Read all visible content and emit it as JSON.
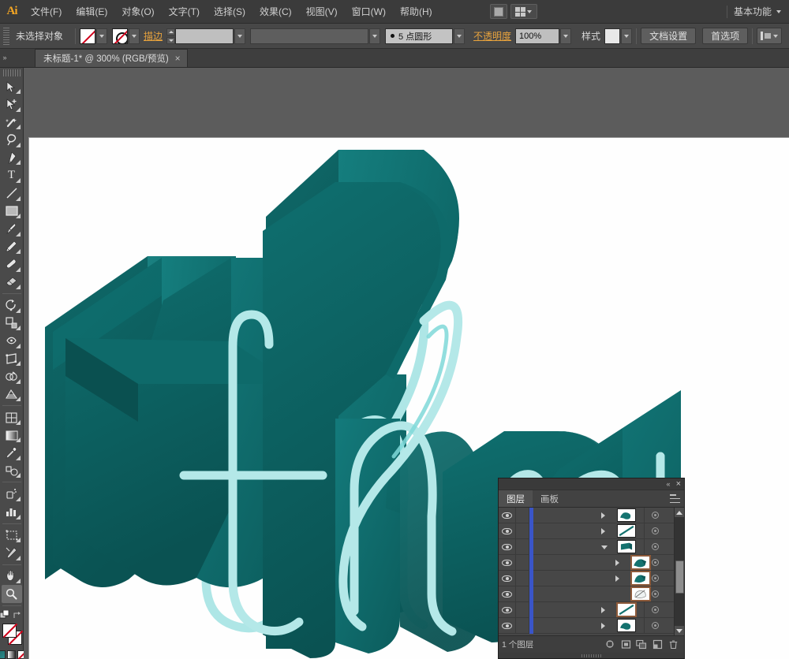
{
  "app": {
    "name": "Adobe Illustrator",
    "logo_text": "Ai",
    "workspace": "基本功能"
  },
  "menubar": {
    "items": [
      {
        "label": "文件(F)",
        "name": "menu-file"
      },
      {
        "label": "编辑(E)",
        "name": "menu-edit"
      },
      {
        "label": "对象(O)",
        "name": "menu-object"
      },
      {
        "label": "文字(T)",
        "name": "menu-type"
      },
      {
        "label": "选择(S)",
        "name": "menu-select"
      },
      {
        "label": "效果(C)",
        "name": "menu-effect"
      },
      {
        "label": "视图(V)",
        "name": "menu-view"
      },
      {
        "label": "窗口(W)",
        "name": "menu-window"
      },
      {
        "label": "帮助(H)",
        "name": "menu-help"
      }
    ],
    "bridge_icon": "bridge-icon",
    "arrange_icon": "arrange-documents-icon"
  },
  "controlbar": {
    "selection_status": "未选择对象",
    "fill_label": "fill-none",
    "stroke_swatch_label": "stroke-none",
    "stroke_link_label": "描边",
    "stroke_weight_value": "",
    "stroke_profile_value": "",
    "brush_definition": "5 点圆形",
    "opacity_label": "不透明度",
    "opacity_value": "100%",
    "style_label": "样式",
    "document_setup_button": "文档设置",
    "preferences_button": "首选项",
    "align_label": "align-options"
  },
  "tabbar": {
    "documents": [
      {
        "title": "未标题-1* @ 300% (RGB/预览)",
        "close": "×",
        "active": true
      }
    ]
  },
  "toolbar": {
    "tools": [
      {
        "name": "selection-tool",
        "glyph": "arrow"
      },
      {
        "name": "direct-selection-tool",
        "glyph": "arrow-plus"
      },
      {
        "name": "magic-wand-tool",
        "glyph": "wand"
      },
      {
        "name": "lasso-tool",
        "glyph": "lasso"
      },
      {
        "name": "pen-tool",
        "glyph": "pen"
      },
      {
        "name": "type-tool",
        "glyph": "T"
      },
      {
        "name": "line-segment-tool",
        "glyph": "line"
      },
      {
        "name": "rectangle-tool",
        "glyph": "rect"
      },
      {
        "name": "paintbrush-tool",
        "glyph": "brush"
      },
      {
        "name": "pencil-tool",
        "glyph": "pencil"
      },
      {
        "name": "blob-brush-tool",
        "glyph": "blob"
      },
      {
        "name": "eraser-tool",
        "glyph": "eraser"
      },
      {
        "name": "rotate-tool",
        "glyph": "rotate"
      },
      {
        "name": "scale-tool",
        "glyph": "scale"
      },
      {
        "name": "width-tool",
        "glyph": "width"
      },
      {
        "name": "free-transform-tool",
        "glyph": "transform"
      },
      {
        "name": "shape-builder-tool",
        "glyph": "shapebuilder"
      },
      {
        "name": "perspective-grid-tool",
        "glyph": "perspective"
      },
      {
        "name": "mesh-tool",
        "glyph": "mesh"
      },
      {
        "name": "gradient-tool",
        "glyph": "gradient"
      },
      {
        "name": "eyedropper-tool",
        "glyph": "eyedropper"
      },
      {
        "name": "blend-tool",
        "glyph": "blend"
      },
      {
        "name": "symbol-sprayer-tool",
        "glyph": "symbol"
      },
      {
        "name": "column-graph-tool",
        "glyph": "graph"
      },
      {
        "name": "artboard-tool",
        "glyph": "artboard"
      },
      {
        "name": "slice-tool",
        "glyph": "slice"
      },
      {
        "name": "hand-tool",
        "glyph": "hand"
      },
      {
        "name": "zoom-tool",
        "glyph": "zoom",
        "active": true
      }
    ],
    "fill_swatch": "none",
    "stroke_swatch": "none",
    "mode_color": "color-mode",
    "mode_gradient": "gradient-mode",
    "mode_none": "none-mode"
  },
  "canvas": {
    "zoom_level": "300%",
    "artwork_title": "thru",
    "colors": {
      "fill_teal": "#146e6e",
      "face_teal": "#0f7070",
      "extrude_dark": "#0d5f5f",
      "outline_cyan": "#aee6e6",
      "highlight_cyan": "#7fd8d8",
      "background": "#fefefe"
    }
  },
  "layers_panel": {
    "tabs": [
      {
        "label": "图层",
        "name": "tab-layers",
        "active": true
      },
      {
        "label": "画板",
        "name": "tab-artboards",
        "active": false
      }
    ],
    "title_controls": {
      "collapse": "«",
      "close": "×"
    },
    "rows": [
      {
        "name": "layer-row-1",
        "visible": true,
        "expanded": false,
        "indent": 0,
        "selected": false,
        "thumb": "art-teal-swirl"
      },
      {
        "name": "layer-row-2",
        "visible": true,
        "expanded": false,
        "indent": 0,
        "selected": false,
        "thumb": "art-teal-stroke"
      },
      {
        "name": "layer-row-3",
        "visible": true,
        "expanded": true,
        "indent": 0,
        "selected": false,
        "thumb": "art-teal-block"
      },
      {
        "name": "layer-row-4",
        "visible": true,
        "expanded": false,
        "indent": 1,
        "selected": true,
        "thumb": "art-teal-swirl"
      },
      {
        "name": "layer-row-5",
        "visible": true,
        "expanded": false,
        "indent": 1,
        "selected": true,
        "thumb": "art-teal-swirl"
      },
      {
        "name": "layer-row-6",
        "visible": true,
        "expanded": false,
        "indent": 1,
        "selected": true,
        "thumb": "art-white-shape"
      },
      {
        "name": "layer-row-7",
        "visible": true,
        "expanded": false,
        "indent": 0,
        "selected": true,
        "thumb": "art-teal-stroke"
      },
      {
        "name": "layer-row-8",
        "visible": true,
        "expanded": false,
        "indent": 0,
        "selected": false,
        "thumb": "art-teal-swirl"
      }
    ],
    "footer": {
      "count_text": "1 个图层",
      "buttons": [
        {
          "name": "locate-object-button",
          "glyph": "locate-icon"
        },
        {
          "name": "make-clipping-mask-button",
          "glyph": "mask-icon"
        },
        {
          "name": "create-new-sublayer-button",
          "glyph": "new-sublayer-icon"
        },
        {
          "name": "create-new-layer-button",
          "glyph": "new-layer-icon"
        },
        {
          "name": "delete-selection-button",
          "glyph": "trash-icon"
        }
      ]
    },
    "scrollbar": {
      "name": "layers-scrollbar"
    }
  }
}
